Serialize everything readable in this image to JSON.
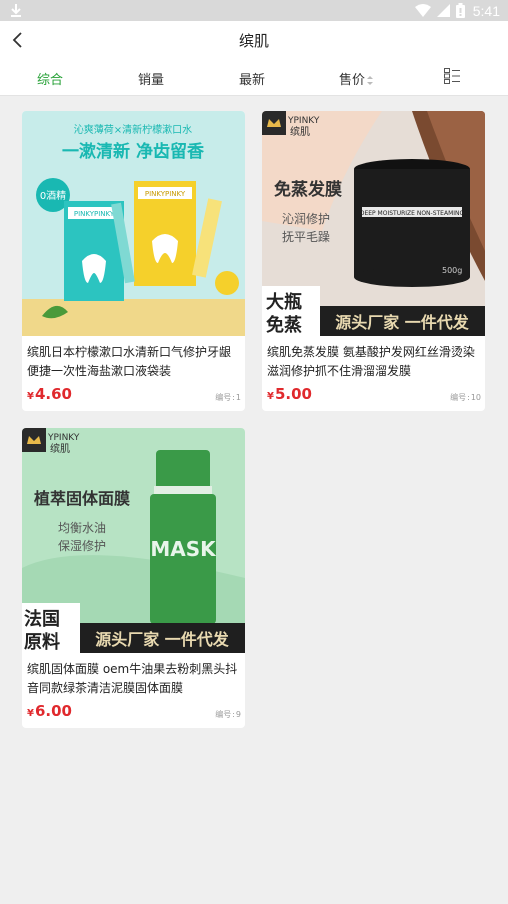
{
  "status_bar": {
    "time": "5:41",
    "icons": [
      "download-icon",
      "wifi-icon",
      "signal-icon",
      "battery-icon"
    ]
  },
  "header": {
    "title": "缤肌",
    "back_icon": "chevron-left-icon"
  },
  "tabs": [
    {
      "label": "综合",
      "active": true
    },
    {
      "label": "销量",
      "active": false
    },
    {
      "label": "最新",
      "active": false
    },
    {
      "label": "售价",
      "active": false,
      "icon": "sort-arrows-icon"
    }
  ],
  "layout_toggle_icon": "list-view-icon",
  "products": [
    {
      "name": "缤肌日本柠檬漱口水清新口气修护牙龈便捷一次性海盐漱口液袋装",
      "currency": "¥",
      "price": "4.60",
      "code_label": "编号",
      "code_sep": ":",
      "code": "1",
      "image": {
        "top_caption": "沁爽薄荷×清新柠檬漱口水",
        "headline": "一漱清新 净齿留香",
        "badge": "0酒精",
        "brand": "PINKYPINKY",
        "colors": {
          "bg": "#c7ecea",
          "accent": "#19b8b2",
          "yellow": "#f5d02b"
        }
      }
    },
    {
      "name": "缤肌免蒸发膜 氨基酸护发网红丝滑烫染滋润修护抓不住滑溜溜发膜",
      "currency": "¥",
      "price": "5.00",
      "code_label": "编号",
      "code_sep": ":",
      "code": "10",
      "image": {
        "brand": "缤肌",
        "brand_en": "YPINKY",
        "headline": "免蒸发膜",
        "sub1": "沁润修护",
        "sub2": "抚平毛躁",
        "jar_label": "DEEP MOISTURIZE NON-STEAMING",
        "jar_weight": "500g",
        "corner_line1": "大瓶",
        "corner_line2": "免蒸",
        "banner": "源头厂家 一件代发",
        "colors": {
          "bg": "#e6ddd6",
          "banner": "#1f1f1f",
          "corner": "#ffffff"
        }
      }
    },
    {
      "name": "缤肌固体面膜 oem牛油果去粉刺黑头抖音同款绿茶清洁泥膜固体面膜",
      "currency": "¥",
      "price": "6.00",
      "code_label": "编号",
      "code_sep": ":",
      "code": "9",
      "image": {
        "brand": "缤肌",
        "brand_en": "YPINKY",
        "headline": "植萃固体面膜",
        "sub1": "均衡水油",
        "sub2": "保湿修护",
        "stick_text": "MASK",
        "corner_line1": "法国",
        "corner_line2": "原料",
        "banner": "源头厂家 一件代发",
        "colors": {
          "bg": "#b7e3c4",
          "stick": "#3a9a48",
          "banner": "#1f1f1f"
        }
      }
    }
  ]
}
